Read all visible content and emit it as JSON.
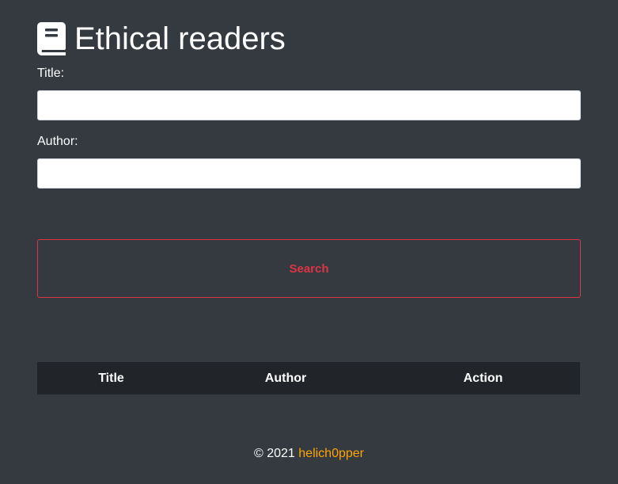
{
  "header": {
    "icon": "book-icon",
    "title": "Ethical readers"
  },
  "form": {
    "title_label": "Title:",
    "title_value": "",
    "author_label": "Author:",
    "author_value": "",
    "search_label": "Search"
  },
  "table": {
    "columns": [
      "Title",
      "Author",
      "Action"
    ],
    "rows": []
  },
  "footer": {
    "copyright": "© 2021",
    "link_text": "helich0pper"
  },
  "colors": {
    "background": "#343a40",
    "table_header": "#212529",
    "danger": "#dc3545",
    "link": "#ffa500"
  }
}
